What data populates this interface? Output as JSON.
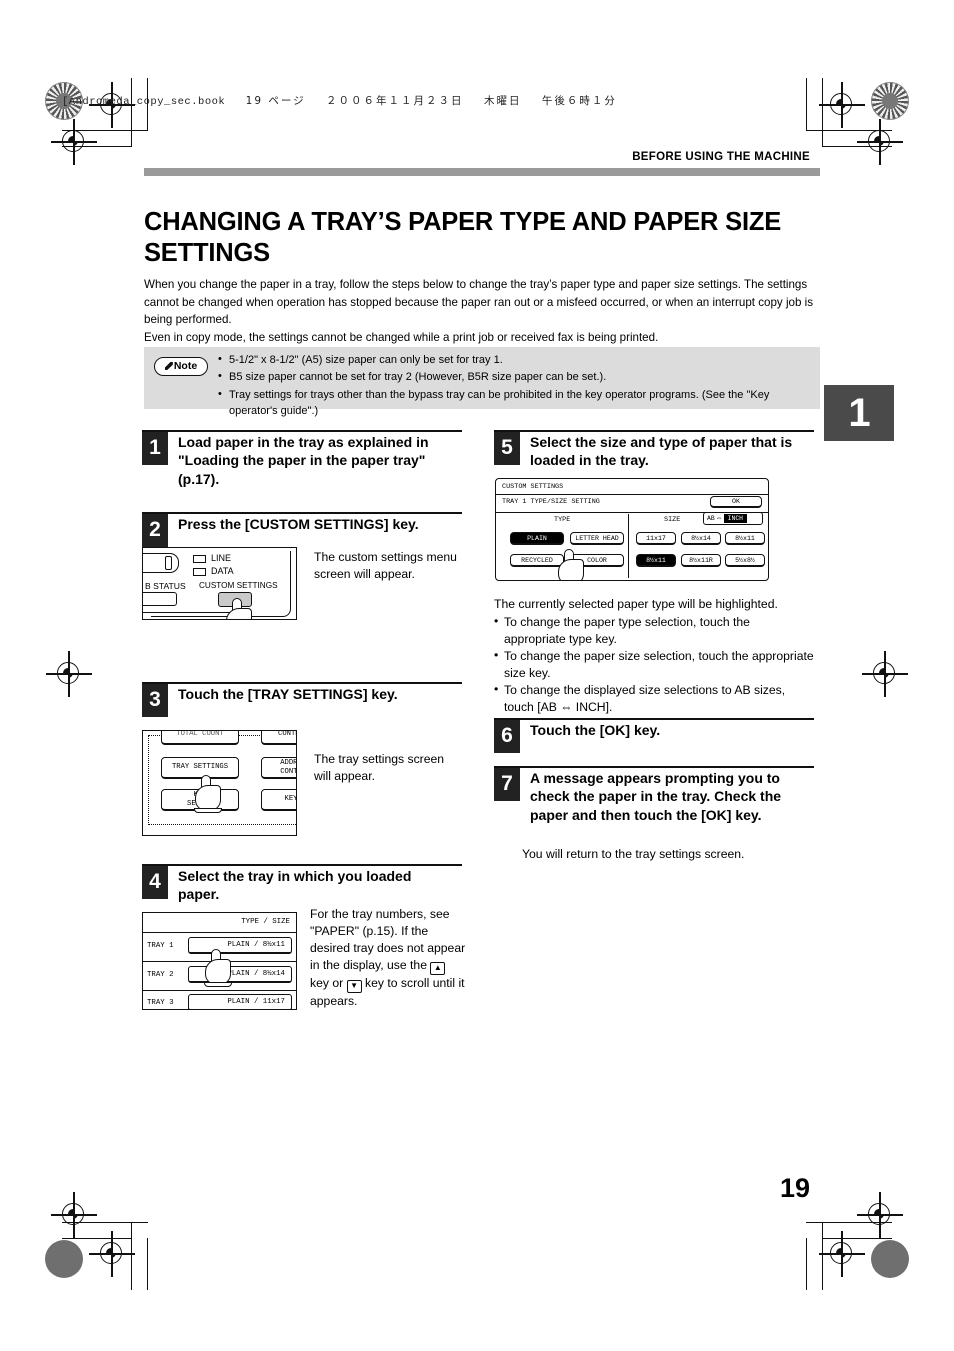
{
  "print_header": {
    "filename": "[Andromeda_copy_sec.book",
    "page_marker": "19 ページ",
    "date": "２００６年１１月２３日",
    "weekday": "木曜日",
    "time": "午後６時１分"
  },
  "running_head": "BEFORE USING THE MACHINE",
  "chapter_tab": "1",
  "page_number": "19",
  "title": "CHANGING A TRAY’S PAPER TYPE AND PAPER SIZE SETTINGS",
  "intro": "When you change the paper in a tray, follow the steps below to change the tray’s paper type and paper size settings. The settings cannot be changed when operation has stopped because the paper ran out or a misfeed occurred, or when an interrupt copy job is being performed.\nEven in copy mode, the settings cannot be changed while a print job or received fax is being printed.",
  "note": {
    "label": "Note",
    "items": [
      "5-1/2\" x 8-1/2\" (A5) size paper can only be set for tray 1.",
      "B5 size paper cannot be set for tray 2 (However, B5R size paper can be set.).",
      "Tray settings for trays other than the bypass tray can be prohibited in the key operator programs. (See the \"Key operator's guide\".)"
    ]
  },
  "steps": {
    "s1": {
      "num": "1",
      "text": "Load paper in the tray as explained in \"Loading the paper in the paper tray\" (p.17)."
    },
    "s2": {
      "num": "2",
      "text": "Press the [CUSTOM SETTINGS] key.",
      "caption": "The custom settings menu screen will appear."
    },
    "s3": {
      "num": "3",
      "text": "Touch the [TRAY SETTINGS] key.",
      "caption": "The tray settings screen will appear."
    },
    "s4": {
      "num": "4",
      "text": "Select the tray in which you loaded paper.",
      "caption_a": "For the tray numbers, see \"PAPER\" (p.15).",
      "caption_b": "If the desired tray does not appear in the display, use the",
      "caption_c": "key or",
      "caption_d": "key to scroll until it appears."
    },
    "s5": {
      "num": "5",
      "text": "Select the size and type of paper that is loaded in the tray.",
      "lead": "The currently selected paper type will be highlighted.",
      "bullets": [
        "To change the paper type selection, touch the appropriate type key.",
        "To change the paper size selection, touch the appropriate size key.",
        "To change the displayed size selections to AB sizes, touch [AB ⇔ INCH]."
      ]
    },
    "s6": {
      "num": "6",
      "text": "Touch the [OK] key."
    },
    "s7": {
      "num": "7",
      "text": "A message appears prompting you to check the paper in the tray. Check the paper and then touch the [OK] key.",
      "caption": "You will return to the tray settings screen."
    }
  },
  "panel_operation": {
    "lamp_line": "LINE",
    "lamp_data": "DATA",
    "job_status": "B STATUS",
    "custom_settings": "CUSTOM SETTINGS"
  },
  "panel_menu": {
    "keys": [
      "TOTAL COUNT",
      "CONTRA",
      "TRAY SETTINGS",
      "ADDRE\nCONTR",
      "KEY\nSELECT",
      "KEY"
    ]
  },
  "panel_tray": {
    "header": "TYPE / SIZE",
    "rows": [
      {
        "label": "TRAY 1",
        "value": "PLAIN / 8½x11"
      },
      {
        "label": "TRAY 2",
        "value": "PLAIN / 8½x14"
      },
      {
        "label": "TRAY 3",
        "value": "PLAIN / 11x17"
      }
    ]
  },
  "panel_typesize": {
    "title": "CUSTOM SETTINGS",
    "subtitle": "TRAY 1 TYPE/SIZE SETTING",
    "ok": "OK",
    "type_header": "TYPE",
    "size_header": "SIZE",
    "ab_label": "AB",
    "inch_label": "INCH",
    "types": [
      {
        "label": "PLAIN",
        "selected": true
      },
      {
        "label": "LETTER HEAD",
        "selected": false
      },
      {
        "label": "RECYCLED",
        "selected": false
      },
      {
        "label": "COLOR",
        "selected": false
      }
    ],
    "sizes": [
      {
        "label": "11x17",
        "selected": false
      },
      {
        "label": "8½x14",
        "selected": false
      },
      {
        "label": "8½x11",
        "selected": false
      },
      {
        "label": "8½x11",
        "selected": true
      },
      {
        "label": "8½x11R",
        "selected": false
      },
      {
        "label": "5½x8½",
        "selected": false
      }
    ]
  },
  "colors": {
    "rule_bar": "#9a9a9a",
    "note_bg": "#dcdcdc",
    "step_num_bg": "#222222",
    "tab_bg": "#4a4a4a"
  }
}
